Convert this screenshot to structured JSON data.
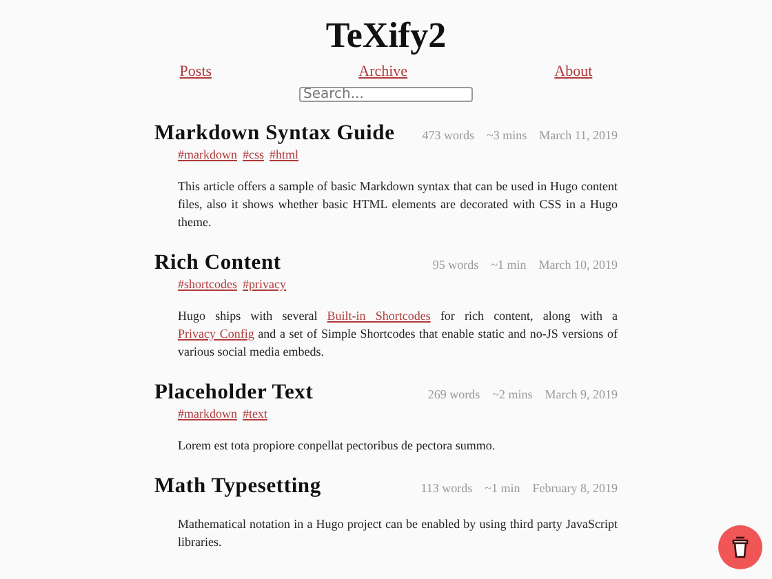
{
  "site_title": "TeXify2",
  "nav": [
    {
      "label": "Posts"
    },
    {
      "label": "Archive"
    },
    {
      "label": "About"
    }
  ],
  "search": {
    "placeholder": "Search..."
  },
  "posts": [
    {
      "title": "Markdown Syntax Guide",
      "words": "473 words",
      "reading_time": "~3 mins",
      "date": "March 11, 2019",
      "tags": [
        "#markdown",
        "#css",
        "#html"
      ],
      "summary": [
        {
          "kind": "text",
          "text": "This article offers a sample of basic Markdown syntax that can be used in Hugo content files, also it shows whether basic HTML elements are decorated with CSS in a Hugo theme."
        }
      ]
    },
    {
      "title": "Rich Content",
      "words": "95 words",
      "reading_time": "~1 min",
      "date": "March 10, 2019",
      "tags": [
        "#shortcodes",
        "#privacy"
      ],
      "summary": [
        {
          "kind": "text",
          "text": "Hugo ships with several"
        },
        {
          "kind": "link",
          "text": "Built-in Shortcodes"
        },
        {
          "kind": "text",
          "text": "for rich content, along with a"
        },
        {
          "kind": "link",
          "text": "Privacy Config"
        },
        {
          "kind": "text",
          "text": "and a set of Simple Shortcodes that enable static and no-JS versions of various social media embeds."
        }
      ]
    },
    {
      "title": "Placeholder Text",
      "words": "269 words",
      "reading_time": "~2 mins",
      "date": "March 9, 2019",
      "tags": [
        "#markdown",
        "#text"
      ],
      "summary": [
        {
          "kind": "text",
          "text": "Lorem est tota propiore conpellat pectoribus de pectora summo."
        }
      ]
    },
    {
      "title": "Math Typesetting",
      "words": "113 words",
      "reading_time": "~1 min",
      "date": "February 8, 2019",
      "summary": [
        {
          "kind": "text",
          "text": "Mathematical notation in a Hugo project can be enabled by using third party JavaScript libraries."
        }
      ]
    }
  ]
}
